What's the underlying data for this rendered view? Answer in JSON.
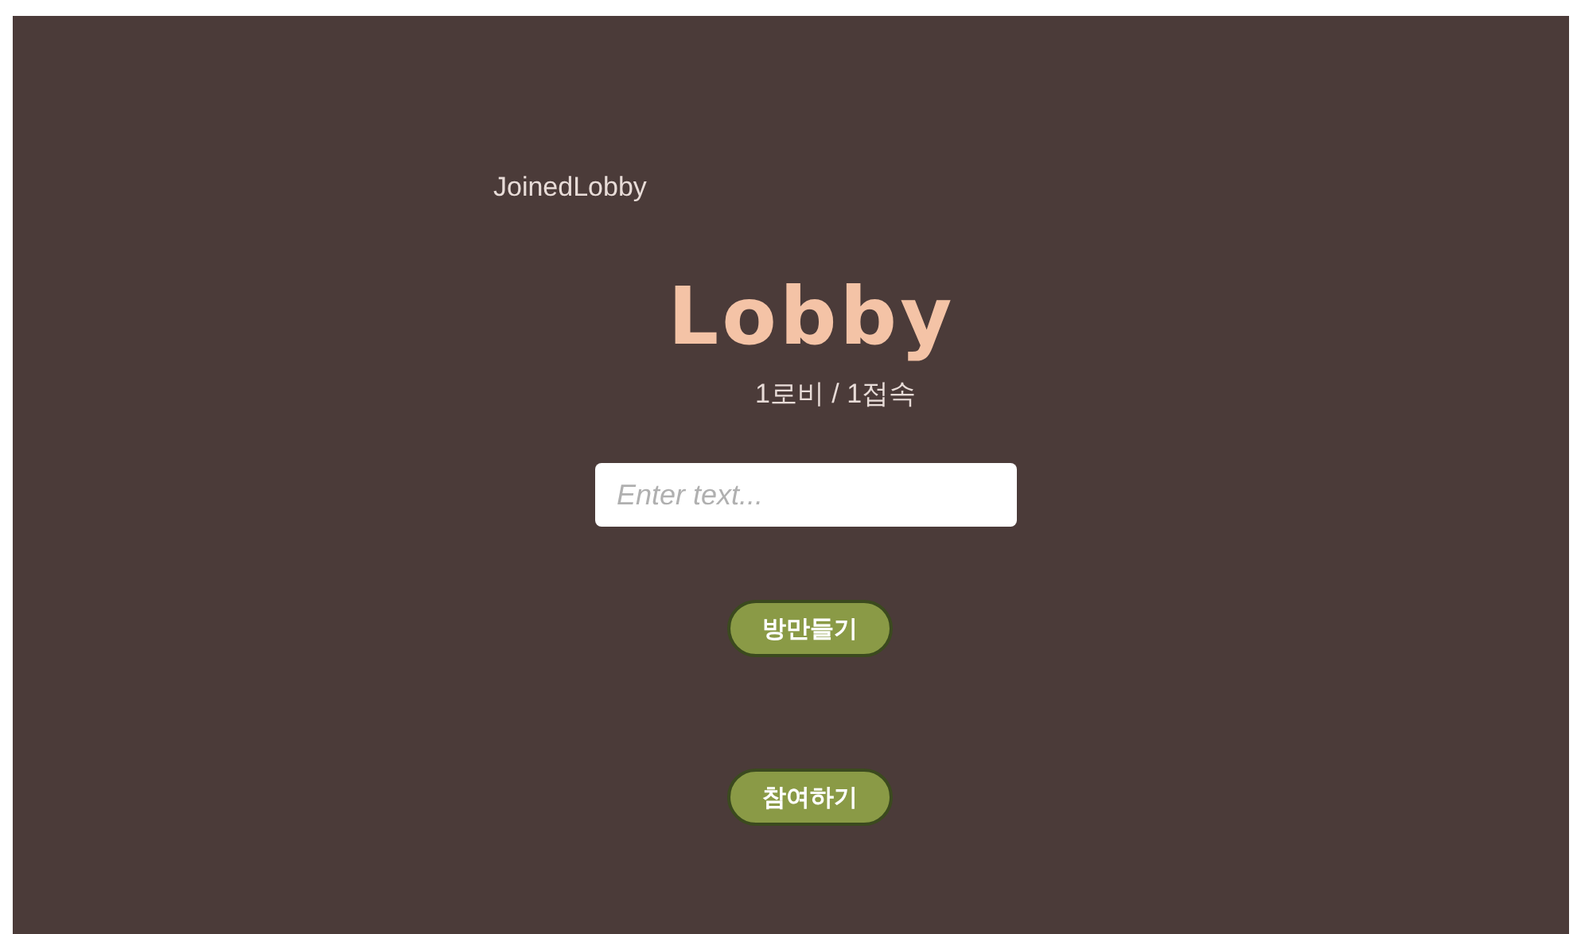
{
  "status": "JoinedLobby",
  "title": "Lobby",
  "counts": "1로비 / 1접속",
  "room_name": {
    "placeholder": "Enter text..."
  },
  "buttons": [
    {
      "label": "방만들기"
    },
    {
      "label": "참여하기"
    }
  ]
}
